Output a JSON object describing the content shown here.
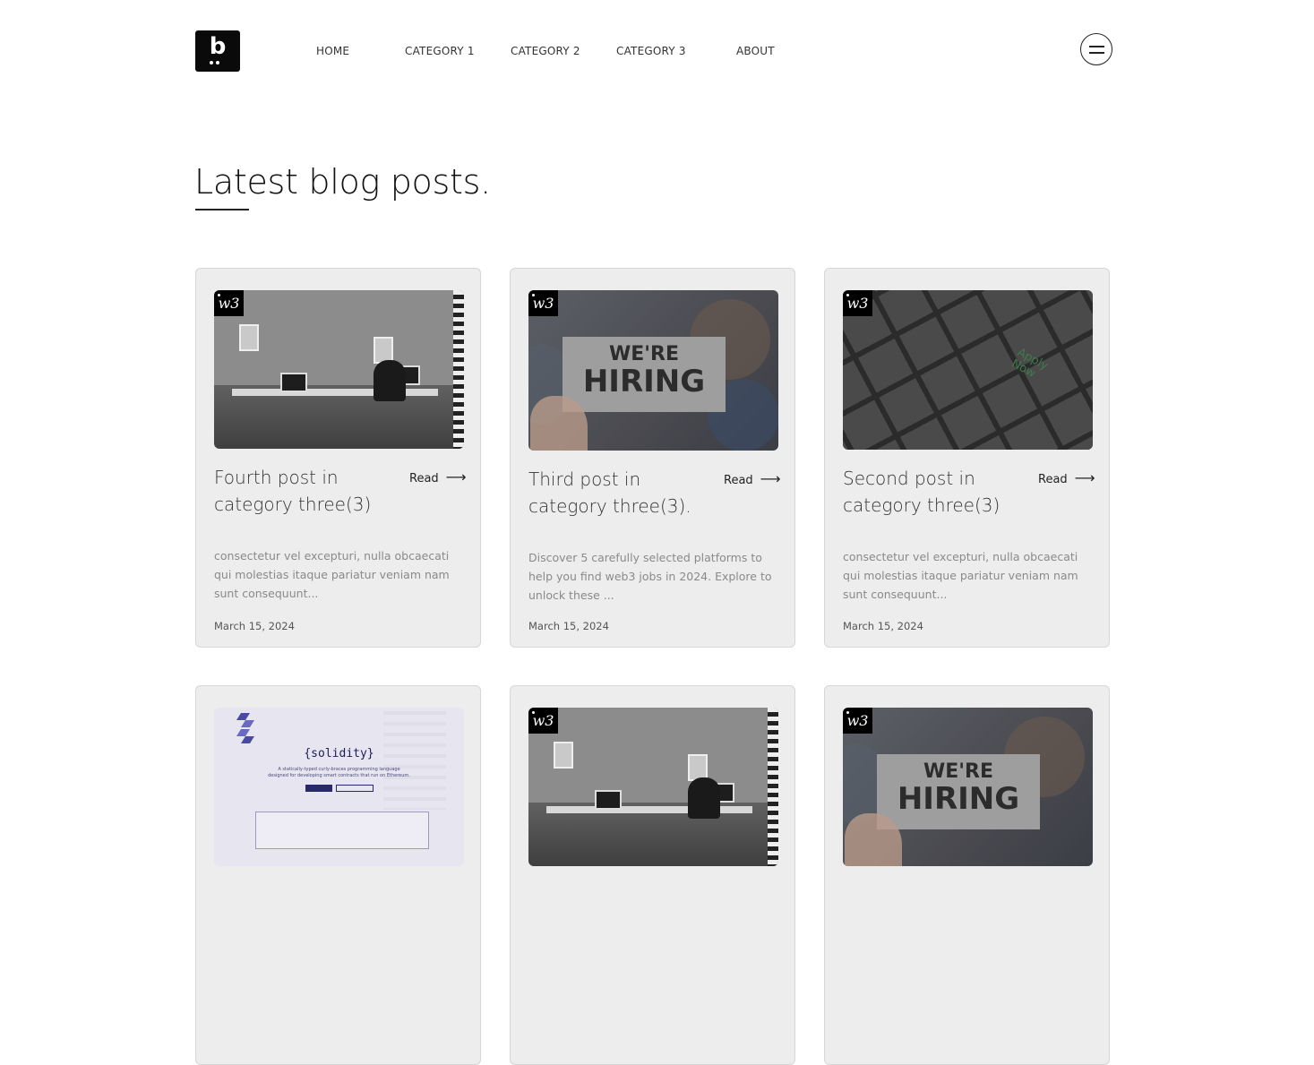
{
  "brand": {
    "logo_letter": "b"
  },
  "nav": {
    "items": [
      {
        "label": "HOME"
      },
      {
        "label": "CATEGORY 1"
      },
      {
        "label": "CATEGORY 2"
      },
      {
        "label": "CATEGORY 3"
      },
      {
        "label": "ABOUT"
      }
    ],
    "menu_icon": "hamburger-menu-icon"
  },
  "page": {
    "title": "Latest blog posts."
  },
  "posts": [
    {
      "image": "office-workspace",
      "badge": "w3",
      "title": "Fourth post in category three(3)",
      "read_label": "Read",
      "excerpt": "consectetur vel excepturi, nulla obcaecati qui molestias itaque pariatur veniam nam sunt consequunt...",
      "date": "March 15, 2024"
    },
    {
      "image": "were-hiring-sign",
      "badge": "w3",
      "title": "Third post in category three(3).",
      "read_label": "Read",
      "excerpt": "Discover 5 carefully selected platforms to help you find web3 jobs in 2024. Explore to unlock these ...",
      "date": "March 15, 2024"
    },
    {
      "image": "apply-now-keyboard",
      "badge": "w3",
      "title": "Second post in category three(3)",
      "read_label": "Read",
      "excerpt": "consectetur vel excepturi, nulla obcaecati qui molestias itaque pariatur veniam nam sunt consequunt...",
      "date": "March 15, 2024"
    },
    {
      "image": "solidity-website",
      "badge": "",
      "solidity": {
        "name": "{solidity}",
        "tagline": "A statically-typed curly-braces programming language designed for developing smart contracts that run on Ethereum."
      }
    },
    {
      "image": "office-workspace",
      "badge": "w3"
    },
    {
      "image": "were-hiring-sign",
      "badge": "w3",
      "sign_line1": "WE'RE",
      "sign_line2": "HIRING"
    }
  ],
  "hiring_sign": {
    "line1": "WE'RE",
    "line2": "HIRING"
  },
  "keyboard_key": {
    "line1": "Apply",
    "line2": "Now"
  },
  "colors": {
    "card_bg": "#ededed",
    "card_border": "#d6d6d6",
    "text_dark": "#222222",
    "text_muted": "#8a8a8a",
    "badge_bg": "#000000"
  }
}
